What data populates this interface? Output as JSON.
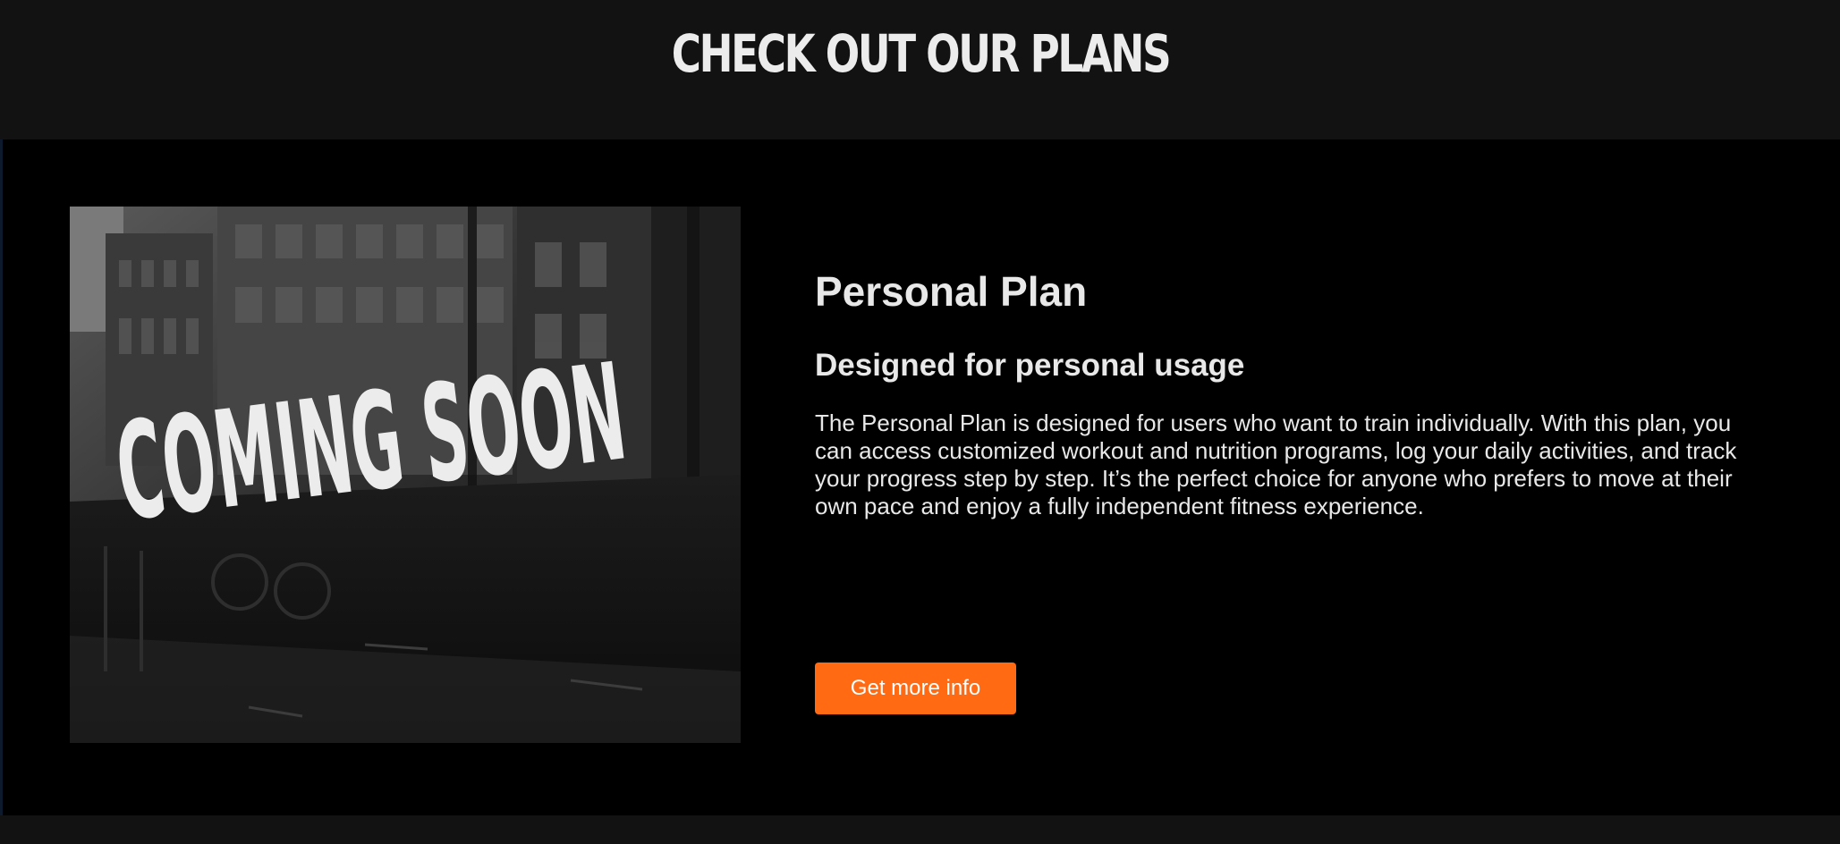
{
  "header": {
    "title": "CHECK OUT OUR PLANS"
  },
  "plan": {
    "image": {
      "sign_text": "COMING SOON"
    },
    "title": "Personal Plan",
    "subtitle": "Designed for personal usage",
    "description": "The Personal Plan is designed for users who want to train individually. With this plan, you can access customized workout and nutrition programs, log your daily activities, and track your progress step by step. It’s the perfect choice for anyone who prefers to move at their own pace and enjoy a fully independent fitness experience.",
    "button_label": "Get more info"
  },
  "colors": {
    "accent": "#ff6a13",
    "background": "#000000",
    "header_background": "#121212",
    "text": "#e8e8e8"
  }
}
